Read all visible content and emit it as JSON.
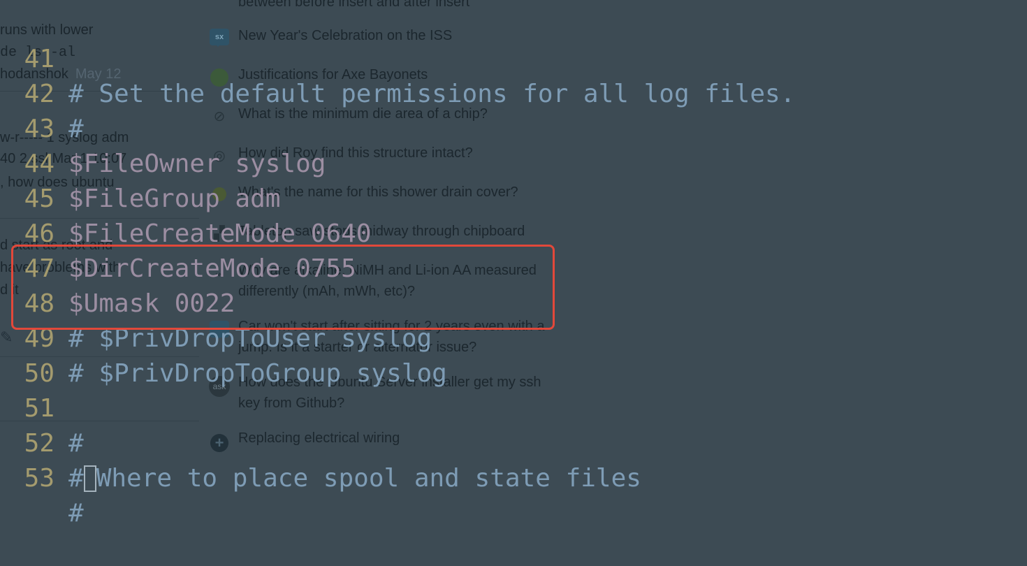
{
  "background_page": {
    "left_snippets": [
      "runs with lower",
      "de  ls  -al",
      "hodanshok",
      "May 12",
      "w-r----- 1 syslog adm",
      "40 2 ssl Mar 1 10:07",
      ", how does ubuntu",
      "d start as root and",
      "have problems with",
      "d it"
    ],
    "top_fragment": "between before insert and after insert",
    "hot_questions": [
      {
        "title": "New Year's Celebration on the ISS",
        "icon": "sx-site-icon"
      },
      {
        "title": "Justifications for Axe Bayonets",
        "icon": "globe-site-icon"
      },
      {
        "title": "What is the minimum die area of a chip?",
        "icon": "chip-site-icon"
      },
      {
        "title": "How did Roy find this structure intact?",
        "icon": "scifi-site-icon"
      },
      {
        "title": "What's the name for this shower drain cover?",
        "icon": "diy-site-icon"
      },
      {
        "title": "Tabletop saw stops midway through chipboard",
        "icon": "woodworking-site-icon"
      },
      {
        "title": "Why are alkaline, NiMH and Li-ion AA measured",
        "title2": "differently (mAh, mWh, etc)?",
        "icon": "electronics-site-icon"
      },
      {
        "title": "Car won't start after sitting for 2 years even with a",
        "title2": "jump. Is it a starter or alternator issue?",
        "icon": "mechanics-site-icon"
      },
      {
        "title": "How does the Ubuntu Server installer get my ssh",
        "title2": "key from Github?",
        "icon": "askubuntu-site-icon"
      },
      {
        "title": "Replacing electrical wiring",
        "icon": "plus-site-icon"
      }
    ],
    "ask_label": "ask",
    "sx_label": "sx"
  },
  "terminal": {
    "lines": [
      {
        "no": "41",
        "text": "# Set the default permissions for all log files."
      },
      {
        "no": "42",
        "text": "#"
      },
      {
        "no": "43",
        "text": "$FileOwner syslog"
      },
      {
        "no": "44",
        "text": "$FileGroup adm"
      },
      {
        "no": "45",
        "text": "$FileCreateMode 0640"
      },
      {
        "no": "46",
        "text": "$DirCreateMode 0755"
      },
      {
        "no": "47",
        "text": "$Umask 0022"
      },
      {
        "no": "48",
        "text": "# $PrivDropToUser syslog"
      },
      {
        "no": "49",
        "text": "# $PrivDropToGroup syslog"
      },
      {
        "no": "50",
        "text": ""
      },
      {
        "no": "51",
        "text": "#"
      },
      {
        "no": "52",
        "text_before": "#",
        "text_after": "Where to place spool and state files"
      },
      {
        "no": "53",
        "text": "#"
      }
    ]
  },
  "colors": {
    "background": "#3d4b54",
    "line_number": "#a49b6e",
    "comment": "#7e9cb5",
    "directive": "#9c8ea2",
    "highlight": "#e2483a"
  }
}
